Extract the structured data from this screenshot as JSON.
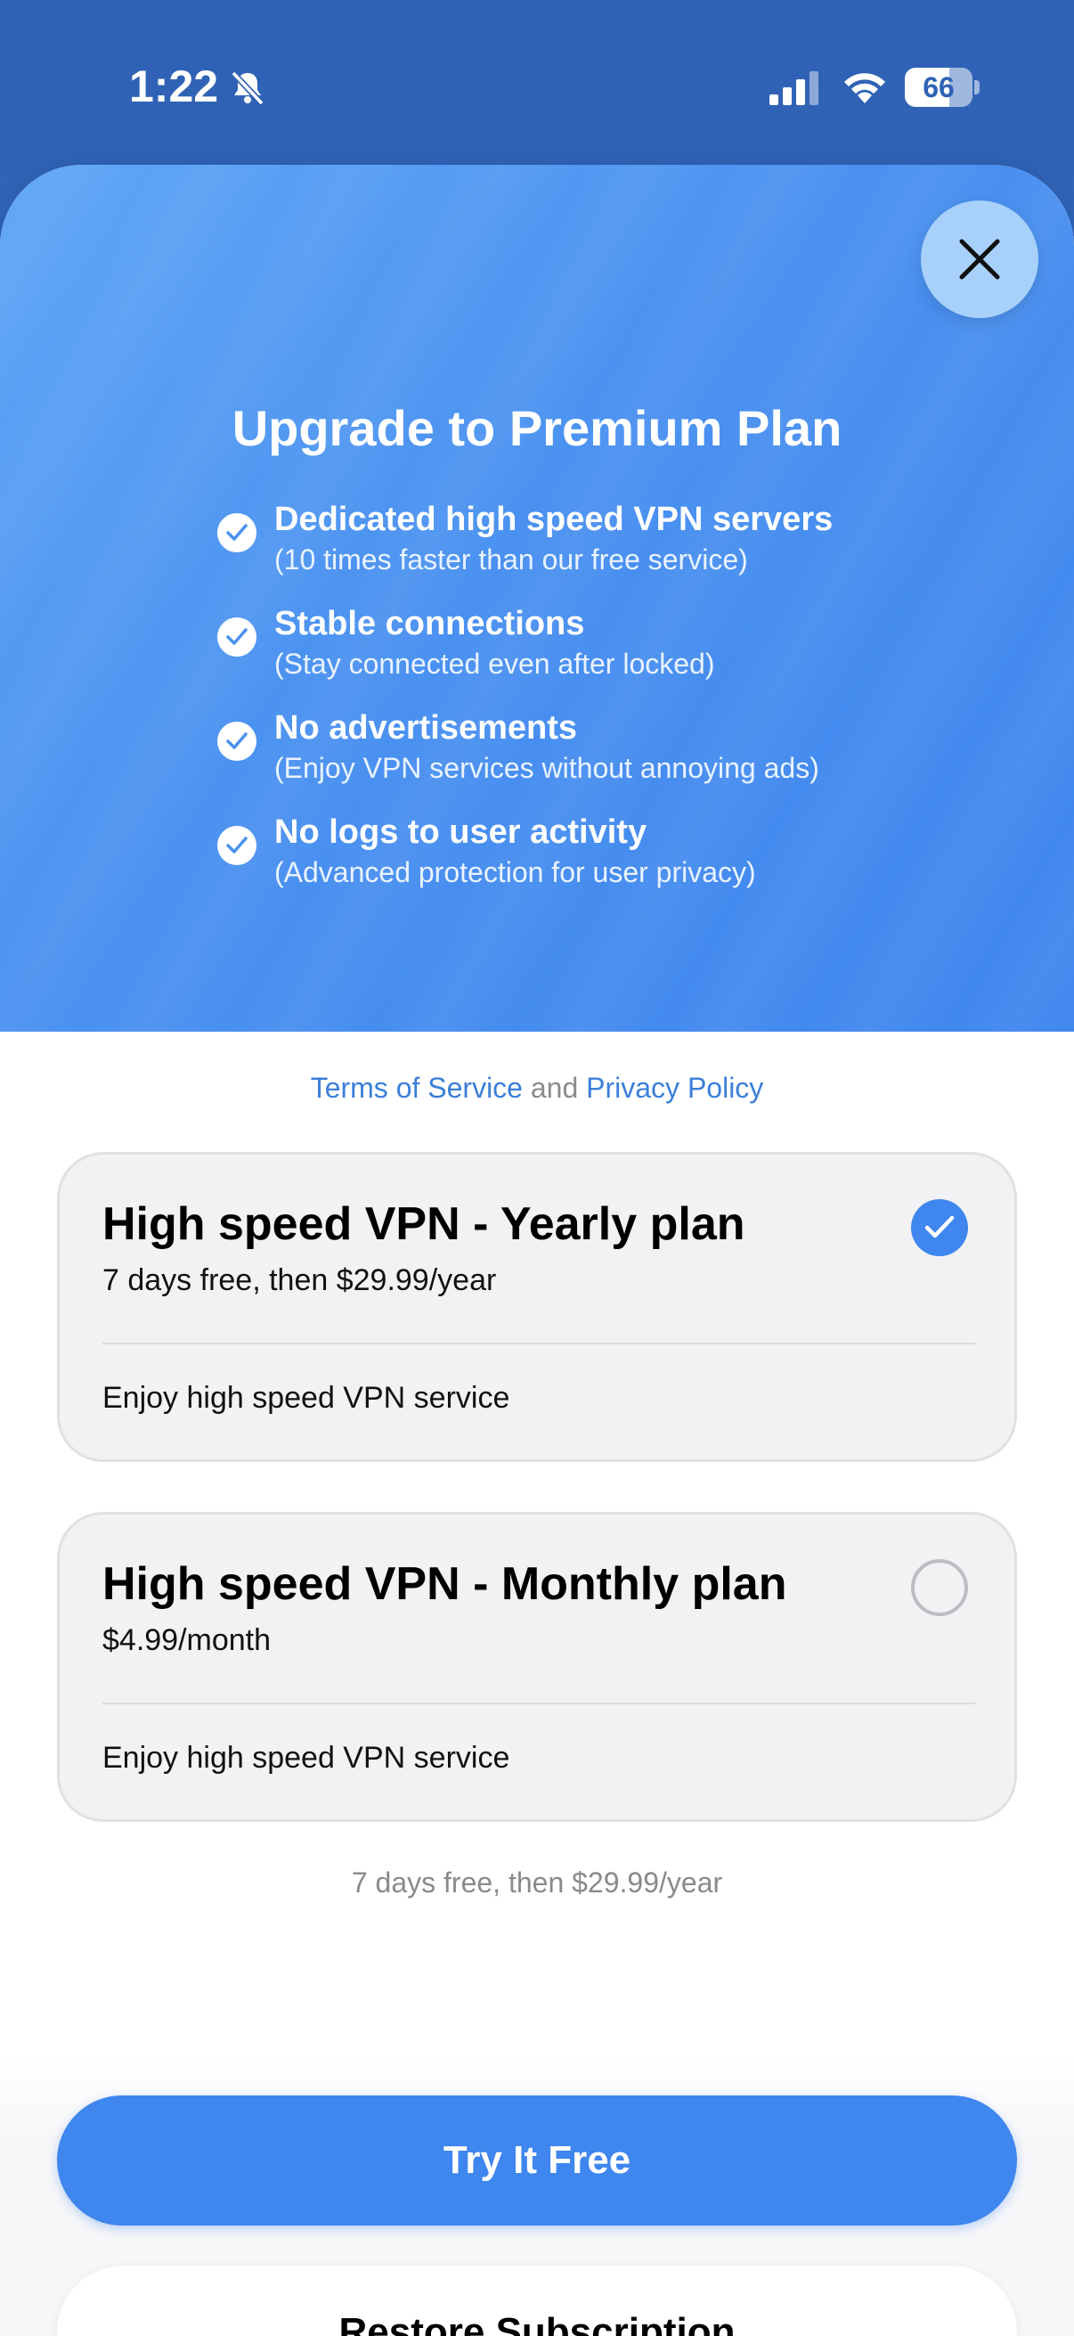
{
  "status_bar": {
    "time": "1:22",
    "battery_percent": "66",
    "battery_level": 0.66,
    "icons": [
      "bell-slash-icon",
      "cellular-signal-icon",
      "wifi-icon",
      "battery-icon"
    ]
  },
  "hero": {
    "title": "Upgrade to Premium Plan",
    "close_icon": "close-icon",
    "features": [
      {
        "title": "Dedicated high speed VPN servers",
        "subtitle": "(10 times faster than our free service)"
      },
      {
        "title": "Stable connections",
        "subtitle": "(Stay connected even after locked)"
      },
      {
        "title": "No advertisements",
        "subtitle": "(Enjoy VPN services without annoying ads)"
      },
      {
        "title": "No logs to user activity",
        "subtitle": "(Advanced protection for user privacy)"
      }
    ]
  },
  "legal": {
    "terms": "Terms of Service",
    "and": "and",
    "privacy": "Privacy Policy"
  },
  "plans": [
    {
      "title": "High speed VPN - Yearly plan",
      "price": "7 days free, then $29.99/year",
      "description": "Enjoy high speed VPN service",
      "selected": true
    },
    {
      "title": "High speed VPN - Monthly plan",
      "price": "$4.99/month",
      "description": "Enjoy high speed VPN service",
      "selected": false
    }
  ],
  "summary": "7 days free, then $29.99/year",
  "buttons": {
    "try_free": "Try It Free",
    "restore": "Restore Subscription"
  },
  "colors": {
    "accent": "#3f86ee",
    "hero_start": "#5fa6f6",
    "hero_end": "#3f86ee",
    "link": "#3b7fd9"
  }
}
